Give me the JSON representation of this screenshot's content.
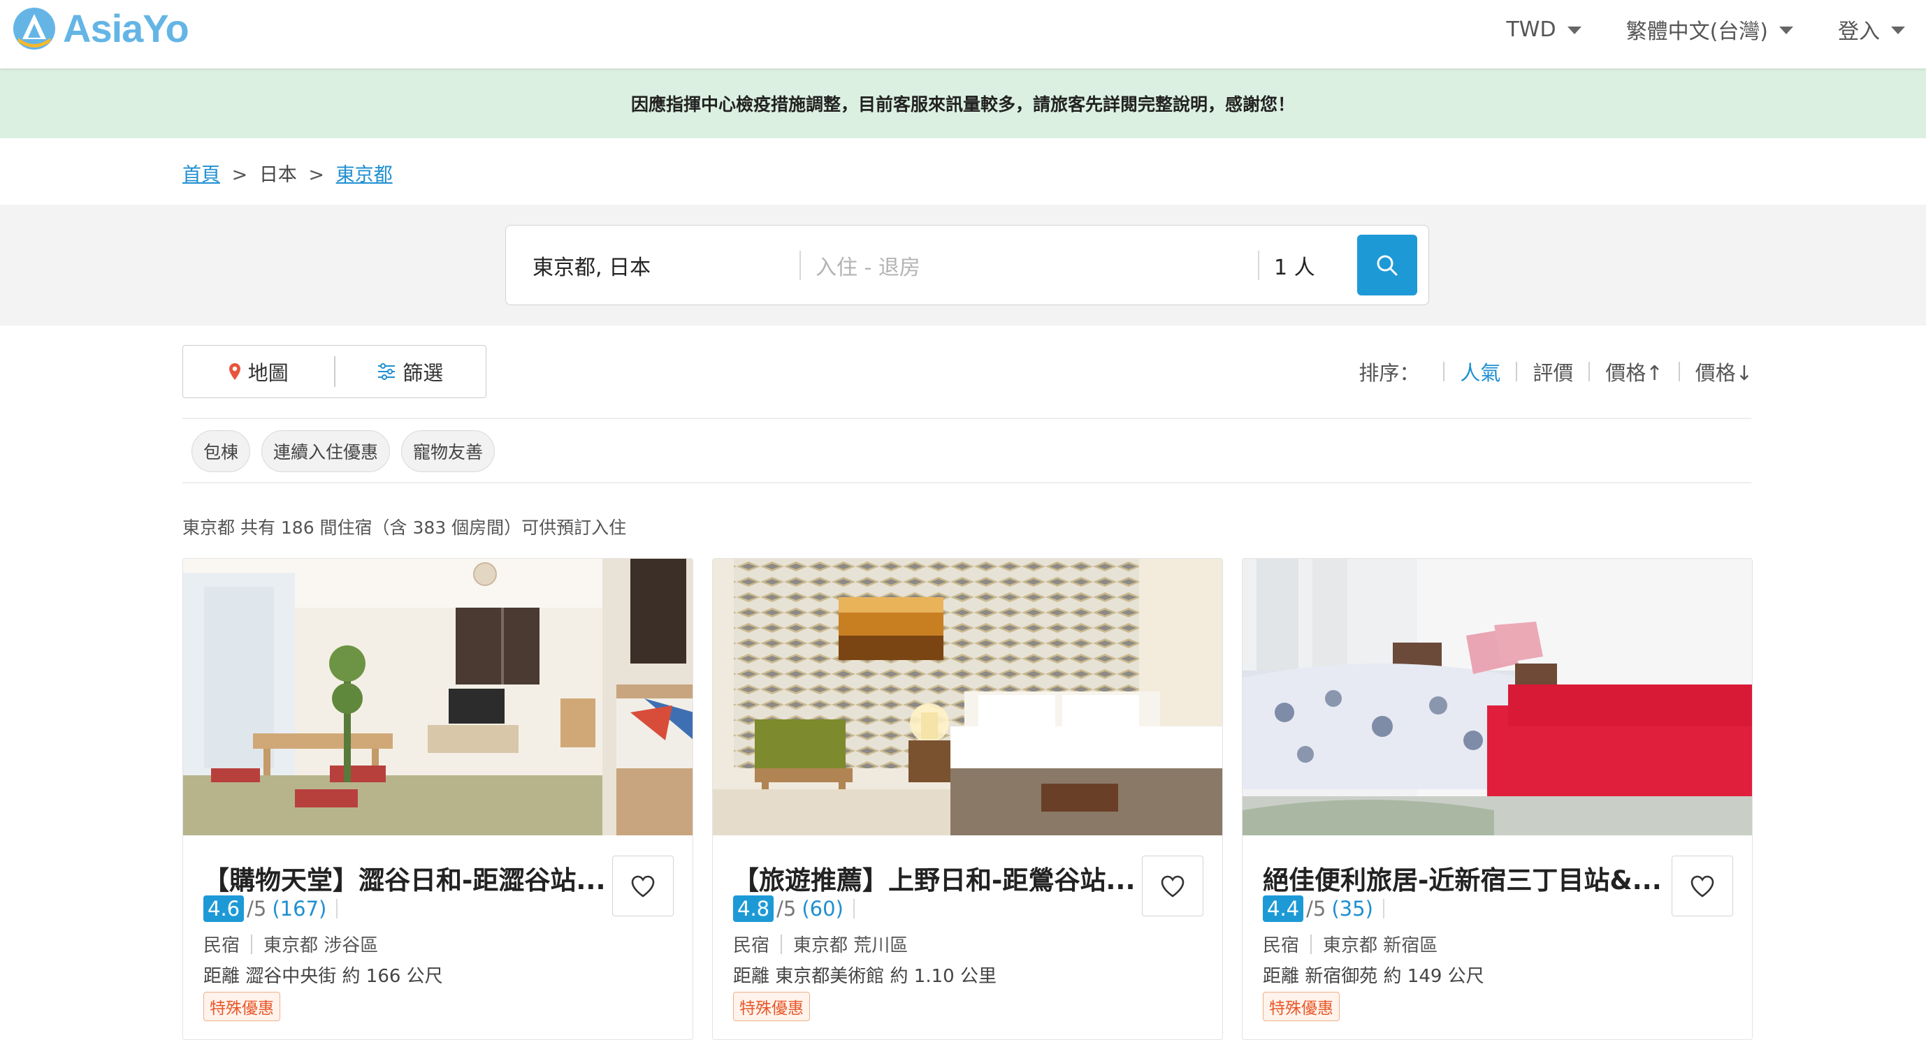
{
  "header": {
    "logo_text": "AsiaYo",
    "currency": "TWD",
    "language": "繁體中文(台灣)",
    "login": "登入"
  },
  "notice": "因應指揮中心檢疫措施調整，目前客服來訊量較多，請旅客先詳閱完整說明，感謝您！",
  "breadcrumb": {
    "home": "首頁",
    "sep1": ">",
    "country": "日本",
    "sep2": ">",
    "city": "東京都"
  },
  "search": {
    "destination": "東京都, 日本",
    "dates_placeholder": "入住 - 退房",
    "guests": "1 人",
    "button_icon": "search-icon"
  },
  "toolbar": {
    "map_label": "地圖",
    "filter_label": "篩選",
    "sort_label": "排序：",
    "sort_options": [
      "人氣",
      "評價",
      "價格↑",
      "價格↓"
    ],
    "sort_active": "人氣"
  },
  "chips": [
    "包棟",
    "連續入住優惠",
    "寵物友善"
  ],
  "result_count": "東京都 共有 186 間住宿（含 383 個房間）可供預訂入住",
  "listings": [
    {
      "title": "【購物天堂】澀谷日和-距澀谷站...",
      "rating": "4.6",
      "rating_max": "/5",
      "review_count": "(167)",
      "type": "民宿",
      "location": "東京都 涉谷區",
      "distance": "距離 澀谷中央街 約 166 公尺",
      "promo": "特殊優惠"
    },
    {
      "title": "【旅遊推薦】上野日和-距鶯谷站...",
      "rating": "4.8",
      "rating_max": "/5",
      "review_count": "(60)",
      "type": "民宿",
      "location": "東京都 荒川區",
      "distance": "距離 東京都美術館 約 1.10 公里",
      "promo": "特殊優惠"
    },
    {
      "title": "絕佳便利旅居-近新宿三丁目站&...",
      "rating": "4.4",
      "rating_max": "/5",
      "review_count": "(35)",
      "type": "民宿",
      "location": "東京都 新宿區",
      "distance": "距離 新宿御苑 約 149 公尺",
      "promo": "特殊優惠"
    }
  ],
  "colors": {
    "accent": "#1d9ad6",
    "link": "#1f8fd1",
    "notice_bg": "#dcf0e2",
    "promo": "#e7582a"
  }
}
